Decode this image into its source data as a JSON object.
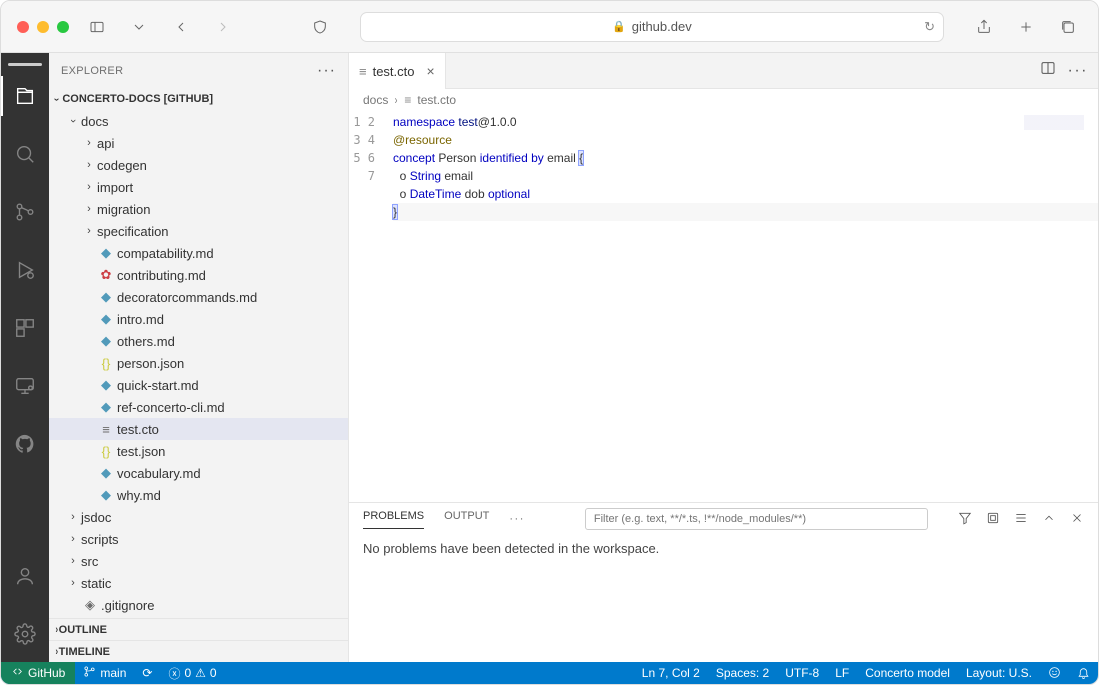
{
  "browser": {
    "url_host": "github.dev"
  },
  "explorer": {
    "title": "EXPLORER",
    "root": "CONCERTO-DOCS [GITHUB]",
    "sections": {
      "outline": "OUTLINE",
      "timeline": "TIMELINE"
    },
    "tree": {
      "docs": "docs",
      "folders": [
        "api",
        "codegen",
        "import",
        "migration",
        "specification"
      ],
      "files": [
        {
          "name": "compatability.md",
          "icon": "md"
        },
        {
          "name": "contributing.md",
          "icon": "contrib"
        },
        {
          "name": "decoratorcommands.md",
          "icon": "md"
        },
        {
          "name": "intro.md",
          "icon": "md"
        },
        {
          "name": "others.md",
          "icon": "md"
        },
        {
          "name": "person.json",
          "icon": "json"
        },
        {
          "name": "quick-start.md",
          "icon": "md"
        },
        {
          "name": "ref-concerto-cli.md",
          "icon": "md"
        },
        {
          "name": "test.cto",
          "icon": "txt",
          "selected": true
        },
        {
          "name": "test.json",
          "icon": "json"
        },
        {
          "name": "vocabulary.md",
          "icon": "md"
        },
        {
          "name": "why.md",
          "icon": "md"
        }
      ],
      "rootFolders": [
        "jsdoc",
        "scripts",
        "src",
        "static"
      ],
      "rootFiles": [
        ".gitignore"
      ]
    }
  },
  "editor": {
    "tab_name": "test.cto",
    "breadcrumbs": [
      "docs",
      "test.cto"
    ],
    "code": {
      "lines": [
        [
          {
            "t": "namespace ",
            "c": "tok-kw"
          },
          {
            "t": "test",
            "c": "tok-nsid"
          },
          {
            "t": "@1.0.0",
            "c": ""
          }
        ],
        [
          {
            "t": "",
            "c": ""
          }
        ],
        [
          {
            "t": "@resource",
            "c": "tok-dec"
          }
        ],
        [
          {
            "t": "concept ",
            "c": "tok-kw"
          },
          {
            "t": "Person ",
            "c": ""
          },
          {
            "t": "identified by ",
            "c": "tok-kw"
          },
          {
            "t": "email ",
            "c": ""
          },
          {
            "t": "{",
            "c": "brace-hl"
          }
        ],
        [
          {
            "t": "  o ",
            "c": ""
          },
          {
            "t": "String ",
            "c": "tok-type"
          },
          {
            "t": "email",
            "c": ""
          }
        ],
        [
          {
            "t": "  o ",
            "c": ""
          },
          {
            "t": "DateTime ",
            "c": "tok-type"
          },
          {
            "t": "dob ",
            "c": ""
          },
          {
            "t": "optional",
            "c": "tok-attr"
          }
        ],
        [
          {
            "t": "}",
            "c": "brace-hl"
          }
        ]
      ],
      "current_line": 7
    }
  },
  "panel": {
    "tabs": {
      "problems": "PROBLEMS",
      "output": "OUTPUT"
    },
    "filter_placeholder": "Filter (e.g. text, **/*.ts, !**/node_modules/**)",
    "message": "No problems have been detected in the workspace."
  },
  "statusbar": {
    "remote": "GitHub",
    "branch": "main",
    "errors": "0",
    "warnings": "0",
    "position": "Ln 7, Col 2",
    "spaces": "Spaces: 2",
    "encoding": "UTF-8",
    "eol": "LF",
    "language": "Concerto model",
    "layout": "Layout: U.S."
  }
}
